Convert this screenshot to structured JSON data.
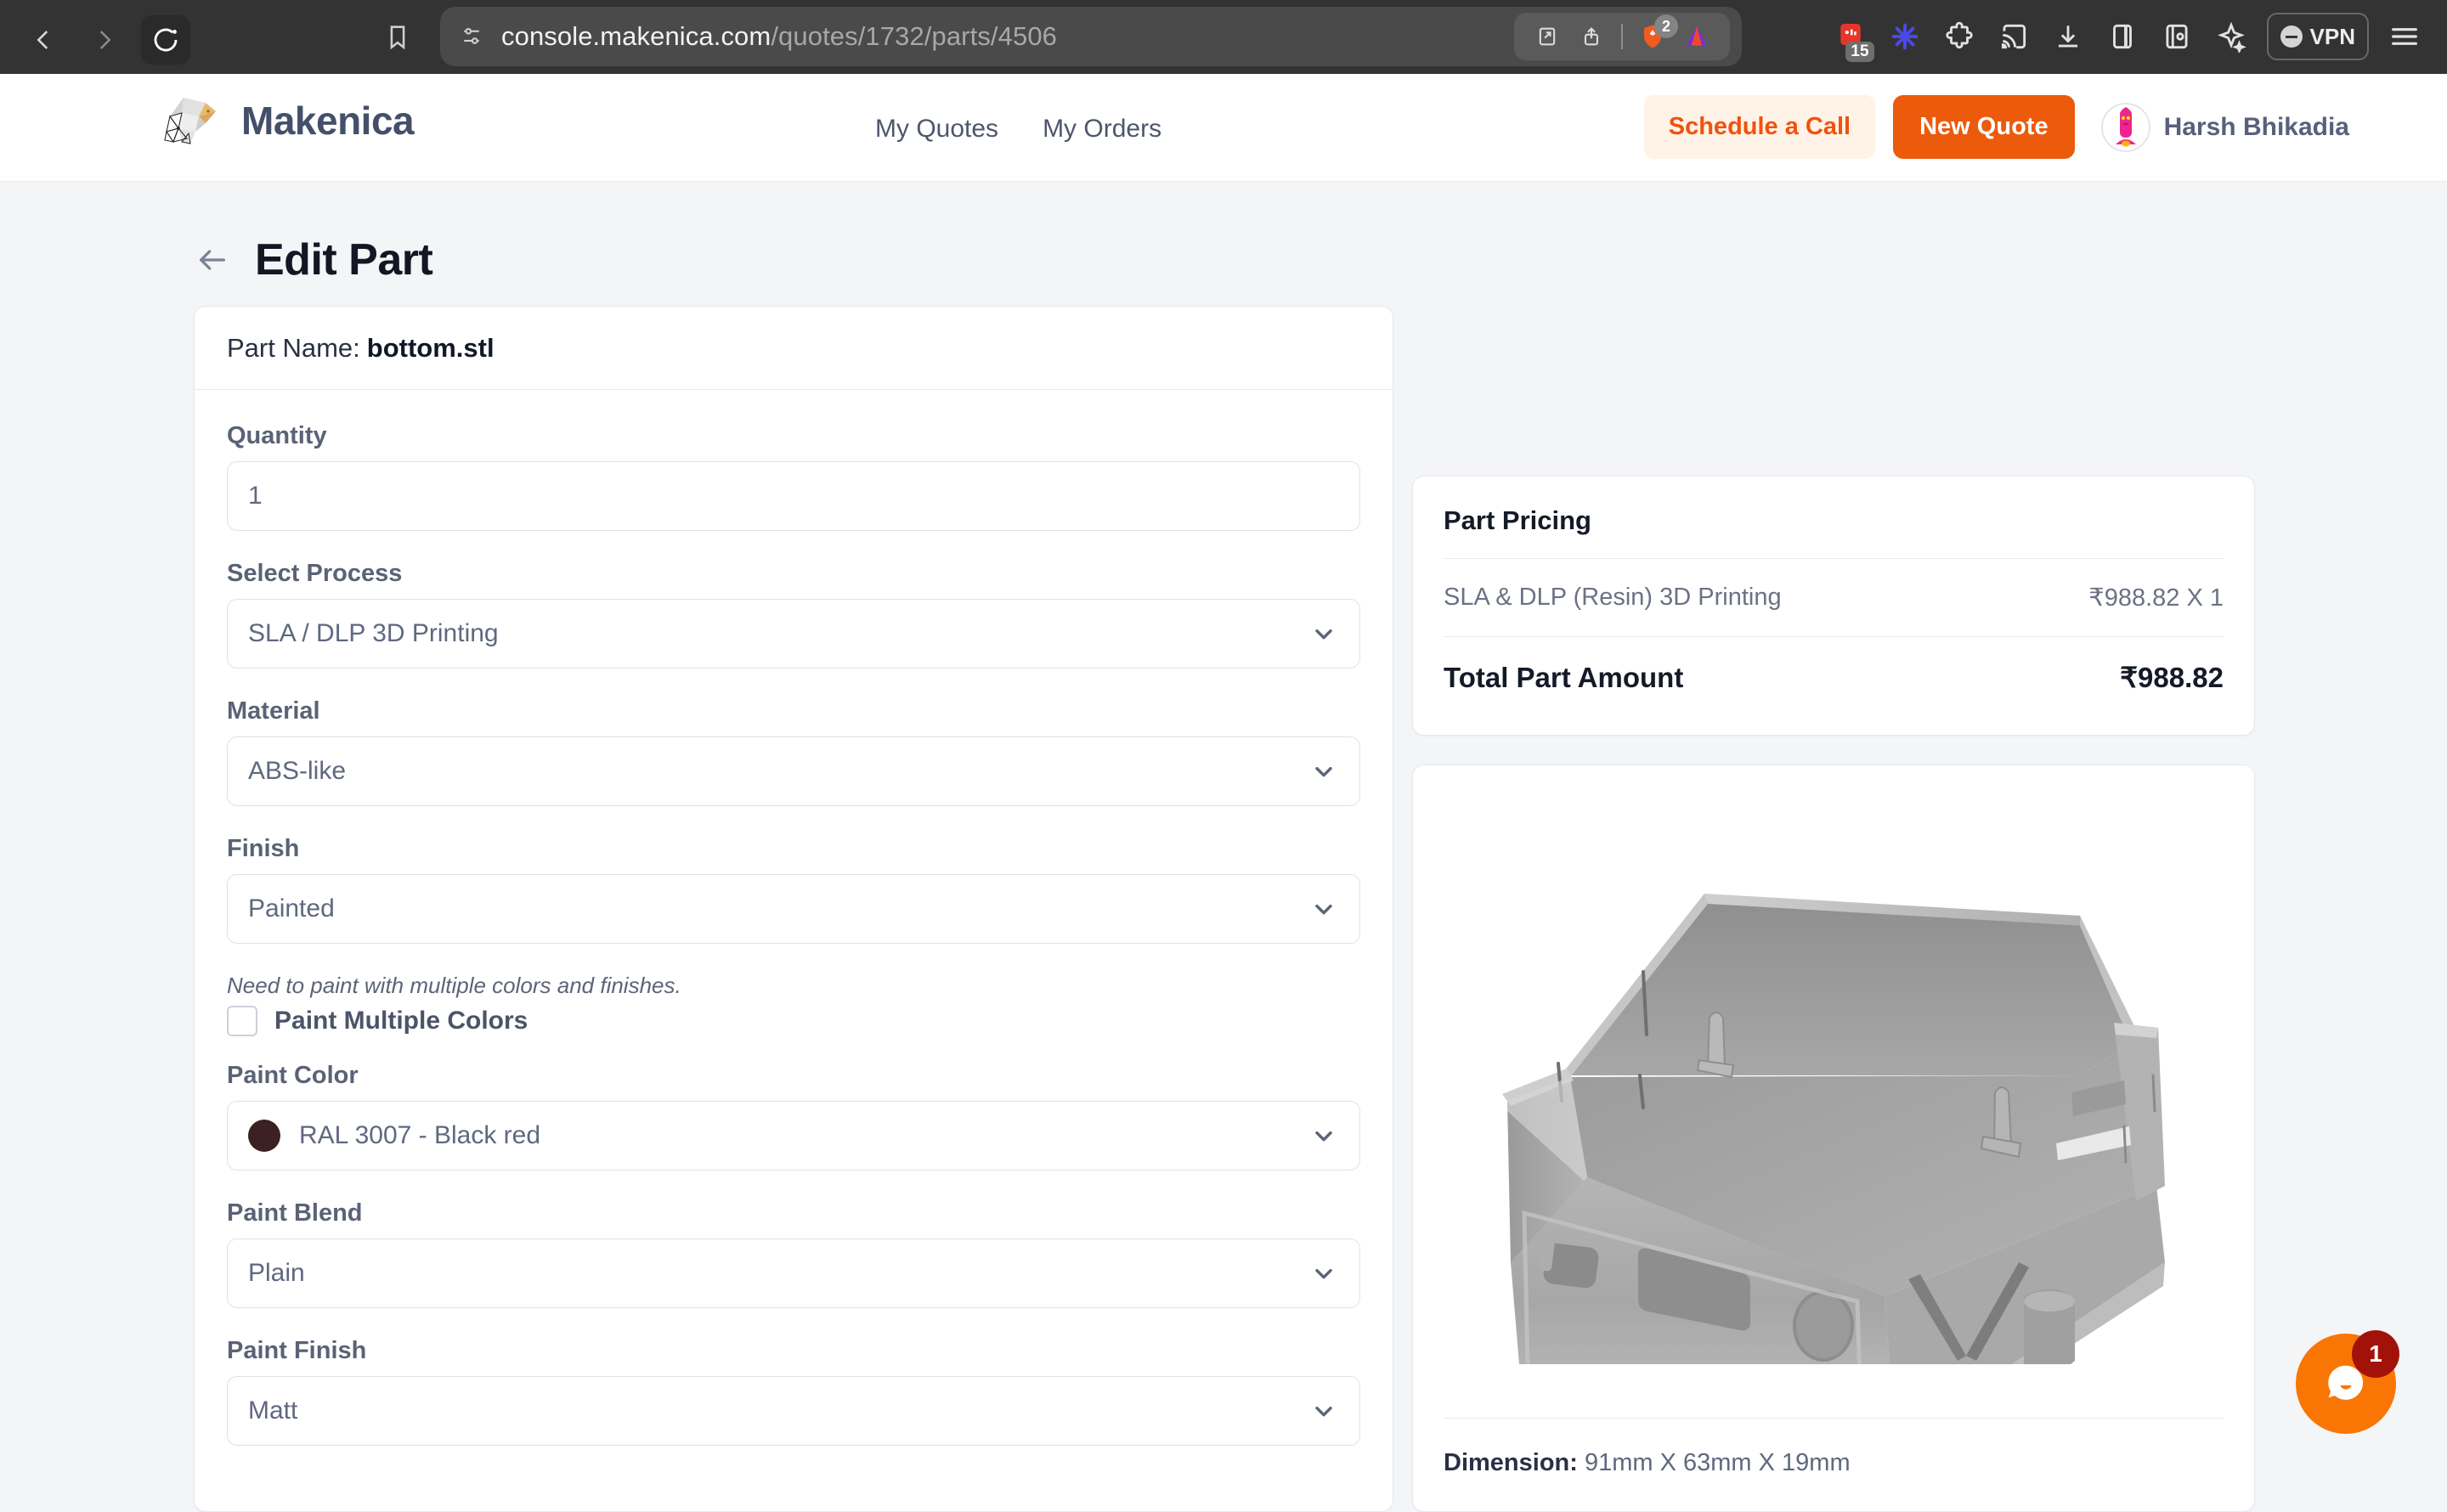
{
  "browser": {
    "url_main": "console.makenica.com",
    "url_path": "/quotes/1732/parts/4506",
    "back_icon": "back-chevron-icon",
    "forward_icon": "forward-chevron-icon",
    "reload_icon": "reload-icon",
    "bookmark_icon": "bookmark-icon",
    "shield_icon": "site-settings-icon",
    "open_in_icon": "open-in-new-icon",
    "share_icon": "share-icon",
    "brave_icon": "brave-shields-icon",
    "brave_badge": "2",
    "extension_icon": "triangle-extension-icon",
    "calendar_badge": "15",
    "vpn_label": "VPN",
    "menu_icon": "hamburger-menu-icon"
  },
  "header": {
    "brand": "Makenica",
    "nav": [
      {
        "label": "My Quotes"
      },
      {
        "label": "My Orders"
      }
    ],
    "schedule_call": "Schedule a Call",
    "new_quote": "New Quote",
    "user_name": "Harsh Bhikadia"
  },
  "page": {
    "title": "Edit Part",
    "back_icon": "back-arrow-icon"
  },
  "part": {
    "name_label": "Part Name:",
    "name_value": "bottom.stl"
  },
  "form": {
    "quantity": {
      "label": "Quantity",
      "value": "1"
    },
    "process": {
      "label": "Select Process",
      "value": "SLA / DLP 3D Printing"
    },
    "material": {
      "label": "Material",
      "value": "ABS-like"
    },
    "finish": {
      "label": "Finish",
      "value": "Painted"
    },
    "paint_multiple": {
      "hint": "Need to paint with multiple colors and finishes.",
      "label": "Paint Multiple Colors",
      "checked": false
    },
    "paint_color": {
      "label": "Paint Color",
      "value": "RAL 3007 - Black red",
      "swatch_hex": "#3d2022"
    },
    "paint_blend": {
      "label": "Paint Blend",
      "value": "Plain"
    },
    "paint_finish": {
      "label": "Paint Finish",
      "value": "Matt"
    }
  },
  "pricing": {
    "title": "Part Pricing",
    "line_label": "SLA & DLP (Resin) 3D Printing",
    "line_value": "₹988.82 X 1",
    "total_label": "Total Part Amount",
    "total_value": "₹988.82"
  },
  "preview": {
    "dimension_label": "Dimension:",
    "dimension_value": "91mm X 63mm X 19mm"
  },
  "chat": {
    "badge": "1",
    "icon": "chat-bubble-icon"
  },
  "colors": {
    "accent_orange": "#eb5b0b",
    "accent_orange_soft": "#fff2e6",
    "brand_navy": "#44506a",
    "page_bg": "#f4f5f7"
  }
}
